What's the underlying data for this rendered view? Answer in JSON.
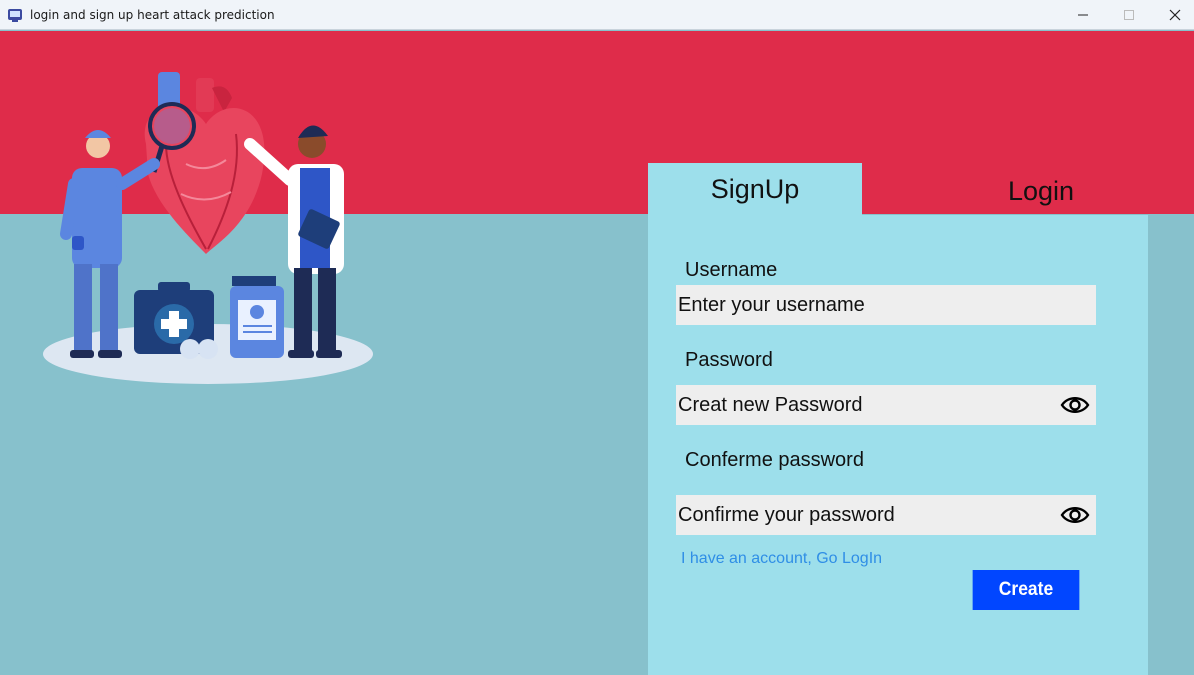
{
  "window": {
    "title": "login and sign up heart attack prediction",
    "app_icon": "app-icon"
  },
  "colors": {
    "header_red": "#df2c4a",
    "background_teal": "#87c1cc",
    "panel": "#9ddfeb",
    "input_bg": "#eeeeee",
    "link": "#2f8ee6",
    "button": "#0146ff"
  },
  "tabs": {
    "signup": "SignUp",
    "login": "Login"
  },
  "form": {
    "username_label": "Username",
    "username_placeholder": "Enter your username",
    "password_label": "Password",
    "password_placeholder": "Creat new Password",
    "confirm_label": "Conferme password",
    "confirm_placeholder": "Confirme your password",
    "goto_login_link": "I have an account, Go LogIn",
    "create_button": "Create"
  },
  "icons": {
    "show_password": "eye-icon",
    "show_confirm": "eye-icon"
  }
}
